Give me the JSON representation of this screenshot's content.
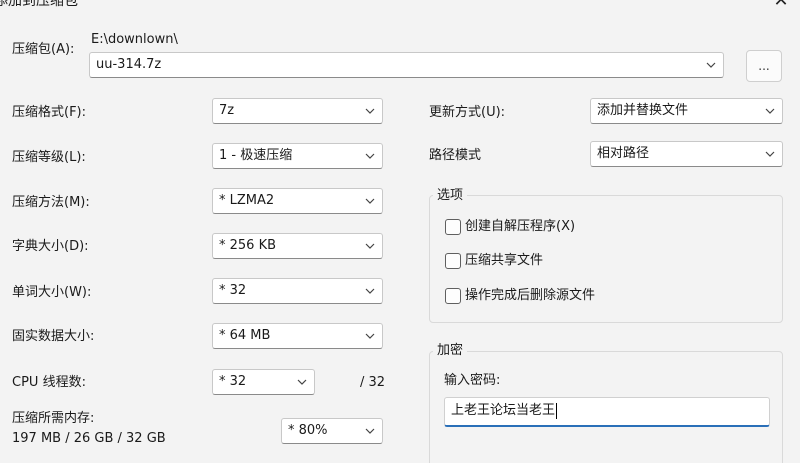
{
  "window": {
    "title": "添加到压缩包",
    "close_glyph": "✕"
  },
  "archive": {
    "label": "压缩包(A):",
    "path": "E:\\downlown\\",
    "filename": "uu-314.7z",
    "browse_label": "..."
  },
  "left": {
    "format": {
      "label": "压缩格式(F):",
      "value": "7z"
    },
    "level": {
      "label": "压缩等级(L):",
      "value": "1 - 极速压缩"
    },
    "method": {
      "label": "压缩方法(M):",
      "value": "* LZMA2"
    },
    "dict": {
      "label": "字典大小(D):",
      "value": "* 256 KB"
    },
    "word": {
      "label": "单词大小(W):",
      "value": "* 32"
    },
    "solid": {
      "label": "固实数据大小:",
      "value": "* 64 MB"
    },
    "threads": {
      "label": "CPU 线程数:",
      "value": "* 32",
      "total": "/ 32"
    },
    "memory": {
      "label": "压缩所需内存:",
      "detail": "197 MB / 26 GB / 32 GB",
      "value": "* 80%"
    }
  },
  "right": {
    "update": {
      "label": "更新方式(U):",
      "value": "添加并替换文件"
    },
    "pathmode": {
      "label": "路径模式",
      "value": "相对路径"
    },
    "options": {
      "title": "选项",
      "items": [
        {
          "label": "创建自解压程序(X)",
          "checked": false
        },
        {
          "label": "压缩共享文件",
          "checked": false
        },
        {
          "label": "操作完成后删除源文件",
          "checked": false
        }
      ]
    },
    "encryption": {
      "title": "加密",
      "password_label": "输入密码:",
      "password_value": "上老王论坛当老王"
    }
  },
  "icons": {
    "dropdown": "chevron-down-icon",
    "close": "close-icon"
  },
  "colors": {
    "background": "#f3f3f3",
    "focus_accent": "#2a6fb8"
  }
}
